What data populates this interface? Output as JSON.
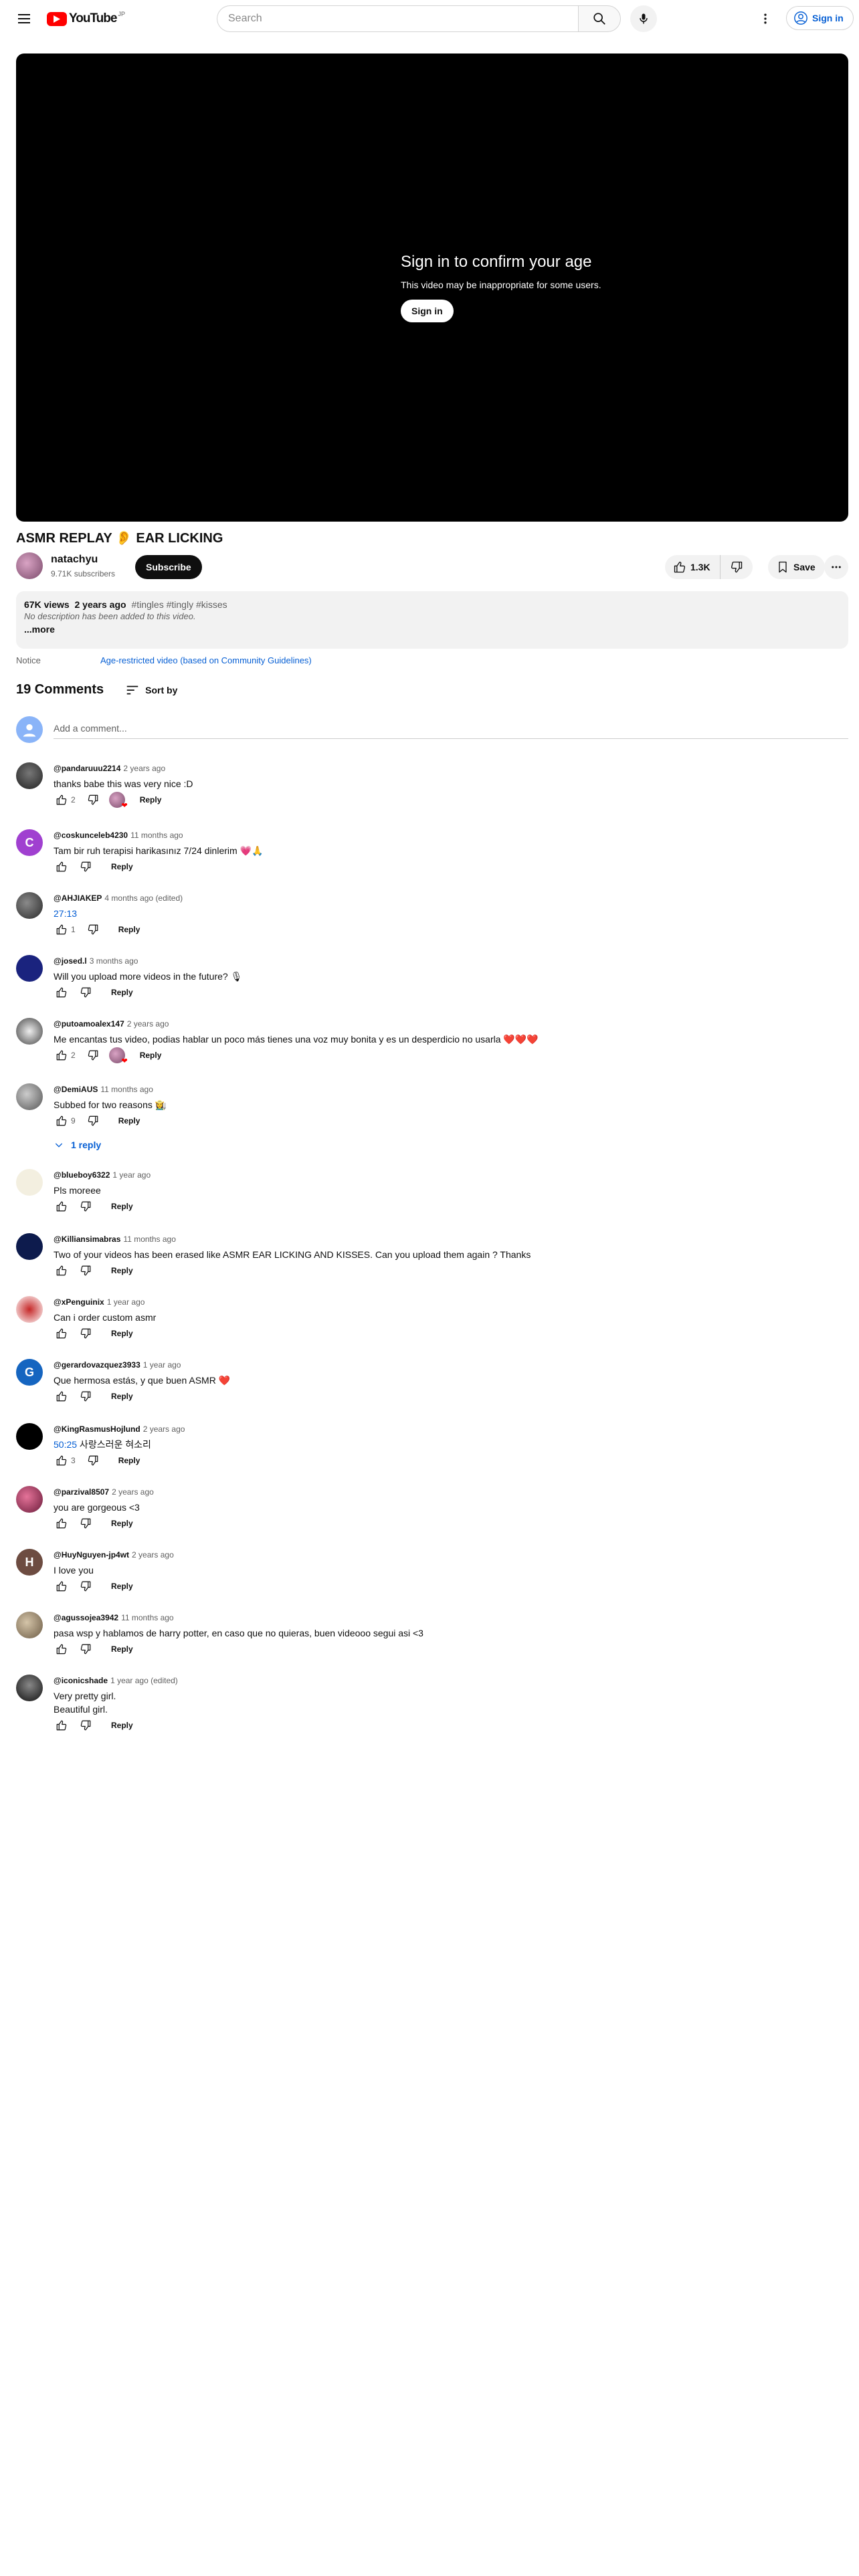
{
  "masthead": {
    "logo_text": "YouTube",
    "logo_superscript": "JP",
    "search_placeholder": "Search",
    "signin_label": "Sign in"
  },
  "player": {
    "title": "Sign in to confirm your age",
    "subtitle": "This video may be inappropriate for some users.",
    "signin_label": "Sign in"
  },
  "video": {
    "title": "ASMR REPLAY 👂 EAR LICKING",
    "channel": "natachyu",
    "subscribers": "9.71K subscribers",
    "subscribe_label": "Subscribe",
    "likes": "1.3K",
    "save_label": "Save"
  },
  "description": {
    "views": "67K views",
    "age": "2 years ago",
    "tags": "#tingles #tingly #kisses",
    "text": "No description has been added to this video.",
    "more": "...more"
  },
  "notice": {
    "label": "Notice",
    "link": "Age-restricted video (based on Community Guidelines)"
  },
  "comments_header": {
    "count": "19 Comments",
    "sort_label": "Sort by",
    "add_placeholder": "Add a comment..."
  },
  "reply_label": "Reply",
  "comments": [
    {
      "author": "@pandaruuu2214",
      "time": "2 years ago",
      "text": "thanks babe this was very nice :D",
      "likes": "2",
      "hearted": true
    },
    {
      "author": "@coskunceleb4230",
      "time": "11 months ago",
      "text": "Tam bir ruh terapisi harikasınız 7/24 dinlerim 💗🙏",
      "likes": "",
      "hearted": false,
      "avatar_letter": "C"
    },
    {
      "author": "@AHJIAKEP",
      "time": "4 months ago (edited)",
      "text": "27:13",
      "likes": "1",
      "hearted": false
    },
    {
      "author": "@josed.l",
      "time": "3 months ago",
      "text": "Will you upload more videos in the future? 🎙",
      "likes": "",
      "hearted": false
    },
    {
      "author": "@putoamoalex147",
      "time": "2 years ago",
      "text": "Me encantas tus video, podias hablar un poco más tienes una voz muy bonita y es un desperdicio no usarla ❤️❤️❤️",
      "likes": "2",
      "hearted": true
    },
    {
      "author": "@DemiAUS",
      "time": "11 months ago",
      "text": "Subbed for two reasons 👩‍🌾",
      "likes": "9",
      "hearted": false,
      "replies": "1 reply"
    },
    {
      "author": "@blueboy6322",
      "time": "1 year ago",
      "text": "Pls moreee",
      "likes": "",
      "hearted": false
    },
    {
      "author": "@Killiansimabras",
      "time": "11 months ago",
      "text": "Two of your videos has been erased like ASMR EAR LICKING AND KISSES. Can you upload them again ? Thanks",
      "likes": "",
      "hearted": false
    },
    {
      "author": "@xPenguinix",
      "time": "1 year ago",
      "text": "Can i order custom asmr",
      "likes": "",
      "hearted": false
    },
    {
      "author": "@gerardovazquez3933",
      "time": "1 year ago",
      "text": "Que hermosa estás, y que buen ASMR ❤️",
      "likes": "",
      "hearted": false,
      "avatar_letter": "G"
    },
    {
      "author": "@KingRasmusHojlund",
      "time": "2 years ago",
      "text_ts": "50:25",
      "text": " 사랑스러운 혀소리",
      "likes": "3",
      "hearted": false
    },
    {
      "author": "@parzival8507",
      "time": "2 years ago",
      "text": "you are gorgeous <3",
      "likes": "",
      "hearted": false
    },
    {
      "author": "@HuyNguyen-jp4wt",
      "time": "2 years ago",
      "text": "I love you",
      "likes": "",
      "hearted": false,
      "avatar_letter": "H"
    },
    {
      "author": "@agussojea3942",
      "time": "11 months ago",
      "text": "pasa wsp y hablamos de harry potter, en caso que no quieras, buen videooo segui asi <3",
      "likes": "",
      "hearted": false
    },
    {
      "author": "@iconicshade",
      "time": "1 year ago (edited)",
      "text": "Very pretty girl.",
      "text2": "Beautiful girl.",
      "likes": "",
      "hearted": false
    }
  ],
  "colors": {
    "brand_red": "#ff0000",
    "link_blue": "#065fd4",
    "chip_gray": "#f2f2f2"
  }
}
